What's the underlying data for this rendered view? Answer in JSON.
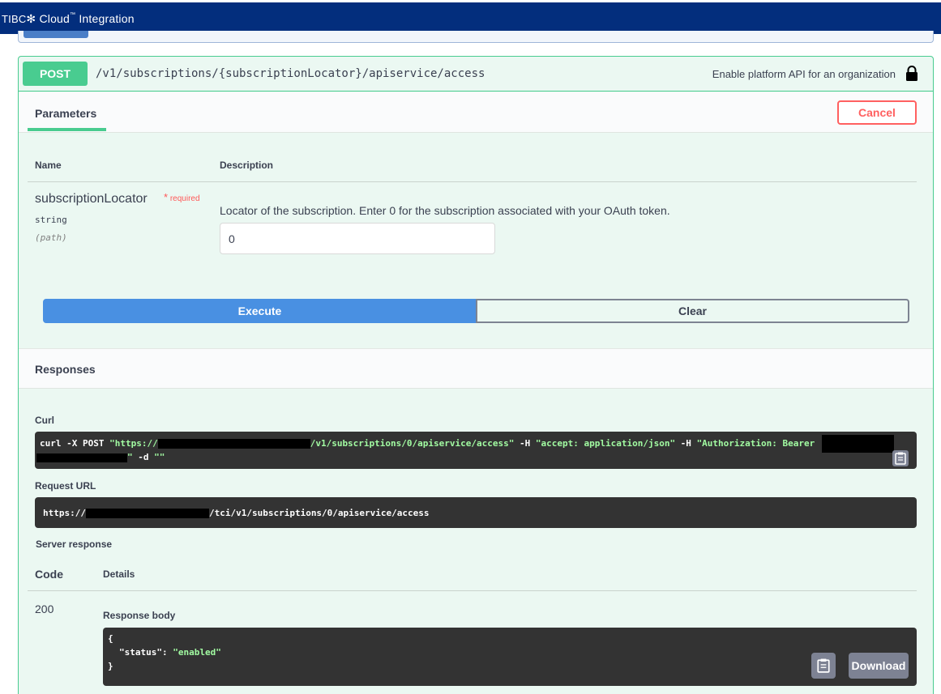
{
  "app": {
    "brand_tibco": "TIBC",
    "brand_cloud": "Cloud",
    "brand_integration": "Integration"
  },
  "operation": {
    "method": "POST",
    "path": "/v1/subscriptions/{subscriptionLocator}/apiservice/access",
    "summary": "Enable platform API for an organization",
    "lock_icon": "lock-icon",
    "tab_parameters": "Parameters",
    "cancel_label": "Cancel"
  },
  "params": {
    "col_name": "Name",
    "col_description": "Description",
    "items": [
      {
        "name": "subscriptionLocator",
        "required_star": "*",
        "required_label": "required",
        "type": "string",
        "in": "(path)",
        "description": "Locator of the subscription. Enter 0 for the subscription associated with your OAuth token.",
        "value": "0"
      }
    ]
  },
  "actions": {
    "execute_label": "Execute",
    "clear_label": "Clear"
  },
  "responses": {
    "title": "Responses",
    "curl_label": "Curl",
    "curl": {
      "cmd": "curl -X POST ",
      "url_start": "\"https://",
      "url_end": "/v1/subscriptions/0/apiservice/access\"",
      "h1_flag": " -H  ",
      "h1": "\"accept: application/json\"",
      "h2_flag": " -H  ",
      "h2": "\"Authorization: Bearer",
      "line2_tail_quote": "\"",
      "line2_flag": " -d ",
      "line2_body": "\"\""
    },
    "request_url_label": "Request URL",
    "request_url_start": "https://",
    "request_url_end": "/tci/v1/subscriptions/0/apiservice/access",
    "server_response_label": "Server response",
    "col_code": "Code",
    "col_details": "Details",
    "code": "200",
    "response_body_label": "Response body",
    "body_open": "{",
    "body_key": "\"status\"",
    "body_colon": ": ",
    "body_value": "\"enabled\"",
    "body_close": "}",
    "download_label": "Download",
    "copy_icon": "clipboard-icon"
  }
}
